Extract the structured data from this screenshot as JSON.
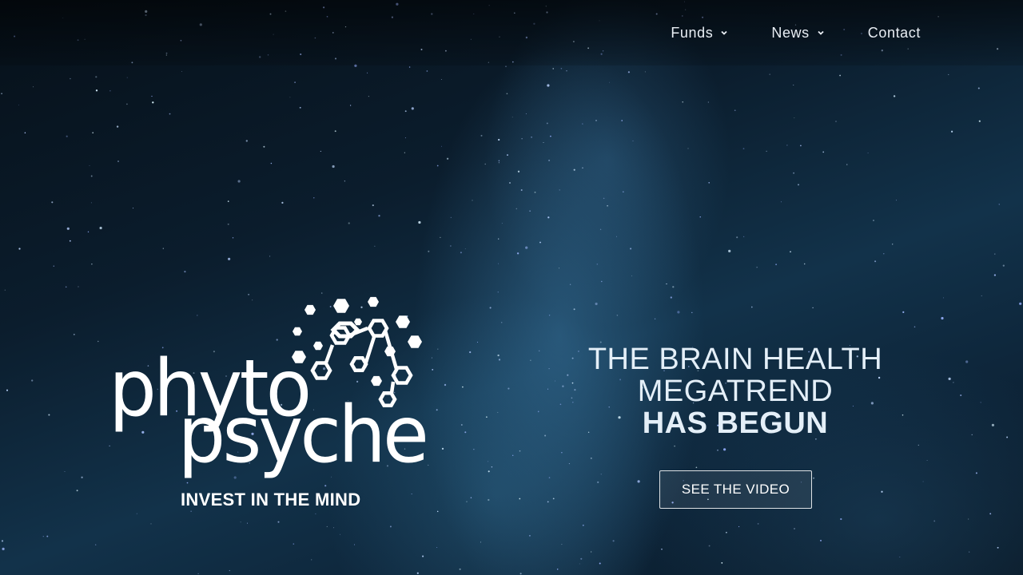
{
  "nav": {
    "items": [
      {
        "label": "Funds",
        "has_dropdown": true
      },
      {
        "label": "News",
        "has_dropdown": true
      },
      {
        "label": "Contact",
        "has_dropdown": false
      }
    ]
  },
  "brand": {
    "logo_word_1": "phyto",
    "logo_word_2": "psyche",
    "tagline": "INVEST IN THE MIND",
    "logo_icon": "hexagon-molecule-icon"
  },
  "hero": {
    "headline_line_1": "THE BRAIN HEALTH",
    "headline_line_2": "MEGATREND",
    "headline_strong": "HAS BEGUN",
    "cta_label": "SEE THE VIDEO"
  },
  "colors": {
    "text": "#e4eff8",
    "sky_dark": "#061019",
    "sky_glow": "#3a76a0"
  }
}
